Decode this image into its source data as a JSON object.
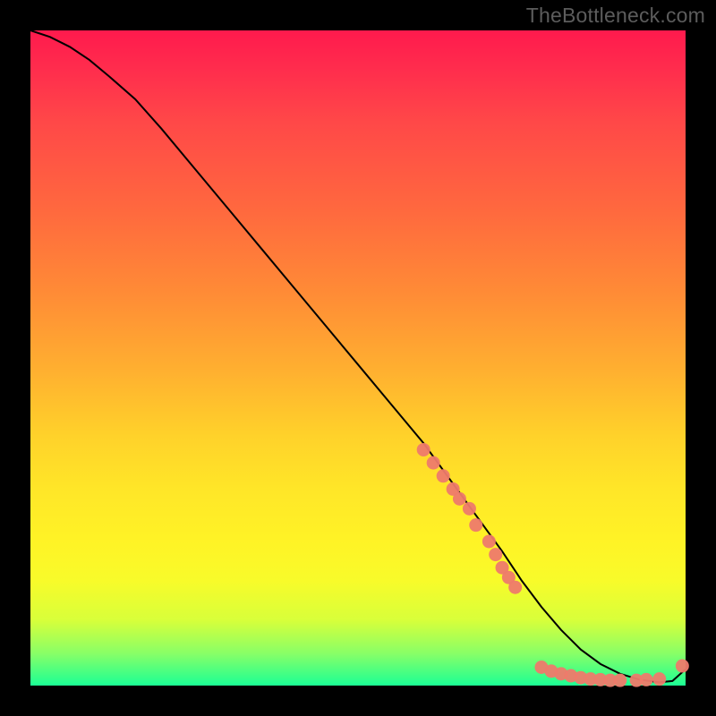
{
  "watermark": "TheBottleneck.com",
  "colors": {
    "background": "#000000",
    "curve": "#000000",
    "dot": "#ee7a6b",
    "gradient_top": "#ff1a4d",
    "gradient_bottom": "#1bff95"
  },
  "chart_data": {
    "type": "line",
    "title": "",
    "xlabel": "",
    "ylabel": "",
    "xlim": [
      0,
      100
    ],
    "ylim": [
      0,
      100
    ],
    "grid": false,
    "series": [
      {
        "name": "curve",
        "style": "line",
        "x": [
          0,
          3,
          6,
          9,
          12,
          16,
          20,
          25,
          30,
          35,
          40,
          45,
          50,
          55,
          60,
          64,
          68,
          72,
          75,
          78,
          81,
          84,
          87,
          90,
          93,
          96,
          98,
          100
        ],
        "y": [
          100,
          99,
          97.5,
          95.5,
          93,
          89.5,
          85,
          79,
          73,
          67,
          61,
          55,
          49,
          43,
          37,
          31.5,
          26,
          20.5,
          16,
          12,
          8.5,
          5.5,
          3.3,
          1.8,
          0.9,
          0.5,
          0.7,
          2.5
        ]
      },
      {
        "name": "markers",
        "style": "scatter",
        "points": [
          {
            "x": 60,
            "y": 36
          },
          {
            "x": 61.5,
            "y": 34
          },
          {
            "x": 63,
            "y": 32
          },
          {
            "x": 64.5,
            "y": 30
          },
          {
            "x": 65.5,
            "y": 28.5
          },
          {
            "x": 67,
            "y": 27
          },
          {
            "x": 68,
            "y": 24.5
          },
          {
            "x": 70,
            "y": 22
          },
          {
            "x": 71,
            "y": 20
          },
          {
            "x": 72,
            "y": 18
          },
          {
            "x": 73,
            "y": 16.5
          },
          {
            "x": 74,
            "y": 15
          },
          {
            "x": 78,
            "y": 2.8
          },
          {
            "x": 79.5,
            "y": 2.2
          },
          {
            "x": 81,
            "y": 1.8
          },
          {
            "x": 82.5,
            "y": 1.5
          },
          {
            "x": 84,
            "y": 1.2
          },
          {
            "x": 85.5,
            "y": 1.0
          },
          {
            "x": 87,
            "y": 0.9
          },
          {
            "x": 88.5,
            "y": 0.8
          },
          {
            "x": 90,
            "y": 0.8
          },
          {
            "x": 92.5,
            "y": 0.8
          },
          {
            "x": 94,
            "y": 0.9
          },
          {
            "x": 96,
            "y": 1.0
          },
          {
            "x": 99.5,
            "y": 3.0
          }
        ]
      }
    ]
  }
}
